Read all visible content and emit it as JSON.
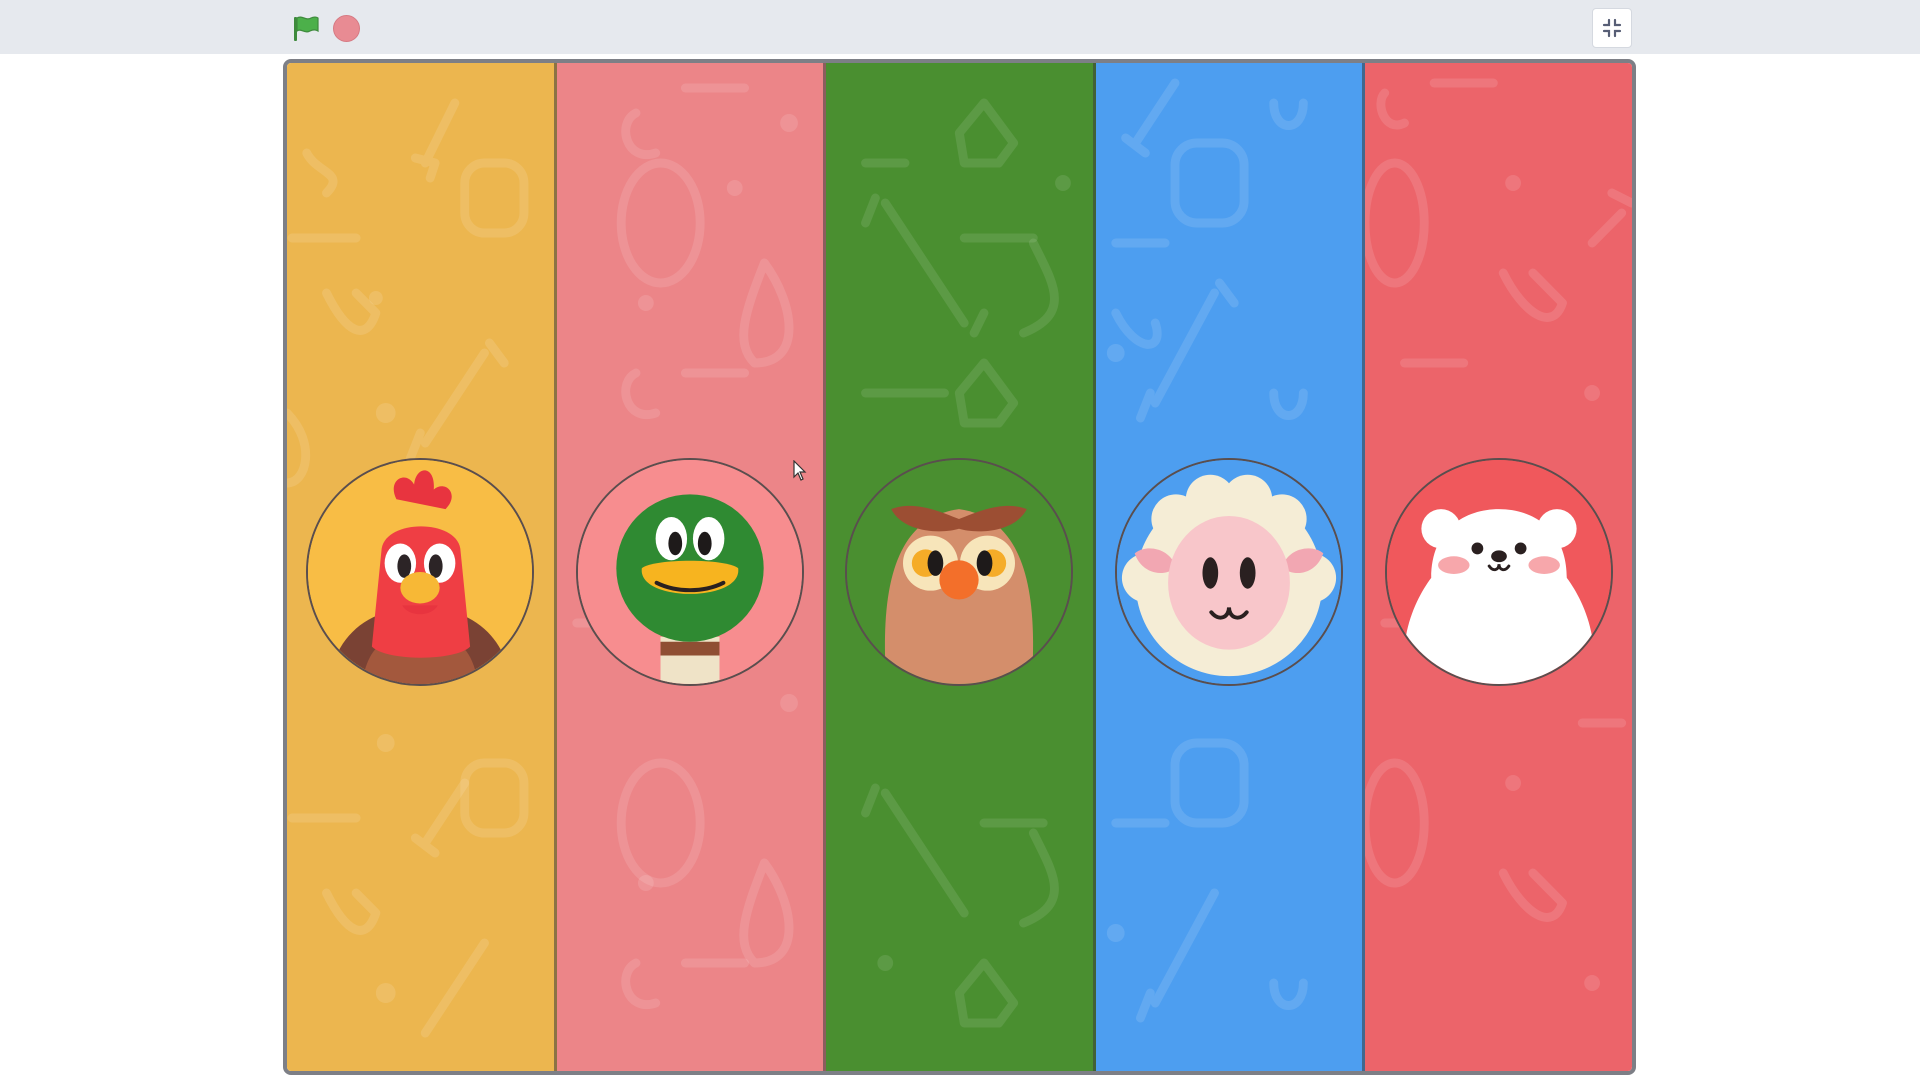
{
  "toolbar": {
    "green_flag_icon": "green-flag-icon",
    "stop_icon": "stop-icon",
    "fullscreen_icon": "exit-fullscreen-icon"
  },
  "colors": {
    "toolbar_bg": "#e6e9ee",
    "flag_green": "#4cb04a",
    "stop_red": "#e88b93",
    "stage_border": "#7d7f86"
  },
  "stage": {
    "columns": [
      {
        "animal": "rooster",
        "bg": "#ecb64f",
        "circle": "#f8bd45"
      },
      {
        "animal": "duck",
        "bg": "#ec8588",
        "circle": "#f78d8f"
      },
      {
        "animal": "owl",
        "bg": "#4a8f30",
        "circle": "#4a8f30"
      },
      {
        "animal": "sheep",
        "bg": "#4d9ef0",
        "circle": "#4d9ef0"
      },
      {
        "animal": "polar-bear",
        "bg": "#ec646a",
        "circle": "#f0585c"
      }
    ]
  }
}
